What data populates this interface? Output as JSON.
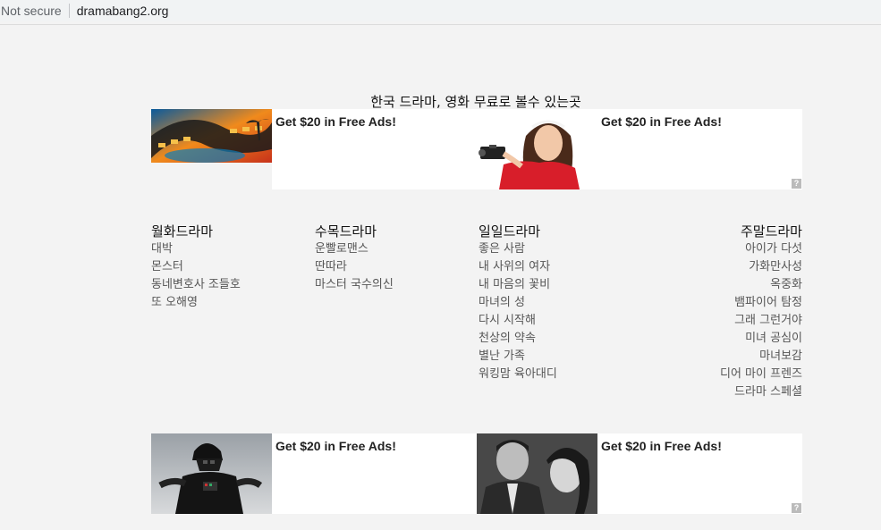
{
  "browser": {
    "security": "Not secure",
    "url": "dramabang2.org"
  },
  "headline": "한국 드라마, 영화 무료로 볼수 있는곳",
  "ads_top": {
    "left": {
      "title": "Get $20 in Free Ads!",
      "image": "film-reel-image"
    },
    "right": {
      "title": "Get $20 in Free Ads!",
      "image": "woman-with-camcorder-image"
    },
    "badge": "?"
  },
  "ads_bottom": {
    "left": {
      "title": "Get $20 in Free Ads!",
      "image": "darth-vader-figure-image"
    },
    "right": {
      "title": "Get $20 in Free Ads!",
      "image": "classic-film-couple-image"
    },
    "badge": "?"
  },
  "columns": [
    {
      "heading": "월화드라마",
      "items": [
        "대박",
        "몬스터",
        "동네변호사 조들호",
        "또 오해영"
      ]
    },
    {
      "heading": "수목드라마",
      "items": [
        "운빨로맨스",
        "딴따라",
        "마스터 국수의신"
      ]
    },
    {
      "heading": "일일드라마",
      "items": [
        "좋은 사람",
        "내 사위의 여자",
        "내 마음의 꽃비",
        "마녀의 성",
        "다시 시작해",
        "천상의 약속",
        "별난 가족",
        "워킹맘 육아대디"
      ]
    },
    {
      "heading": "주말드라마",
      "items": [
        "아이가 다섯",
        "가화만사성",
        "옥중화",
        "뱀파이어 탐정",
        "그래 그런거야",
        "미녀 공심이",
        "마녀보감",
        "디어 마이 프렌즈",
        "드라마 스페셜"
      ]
    }
  ]
}
